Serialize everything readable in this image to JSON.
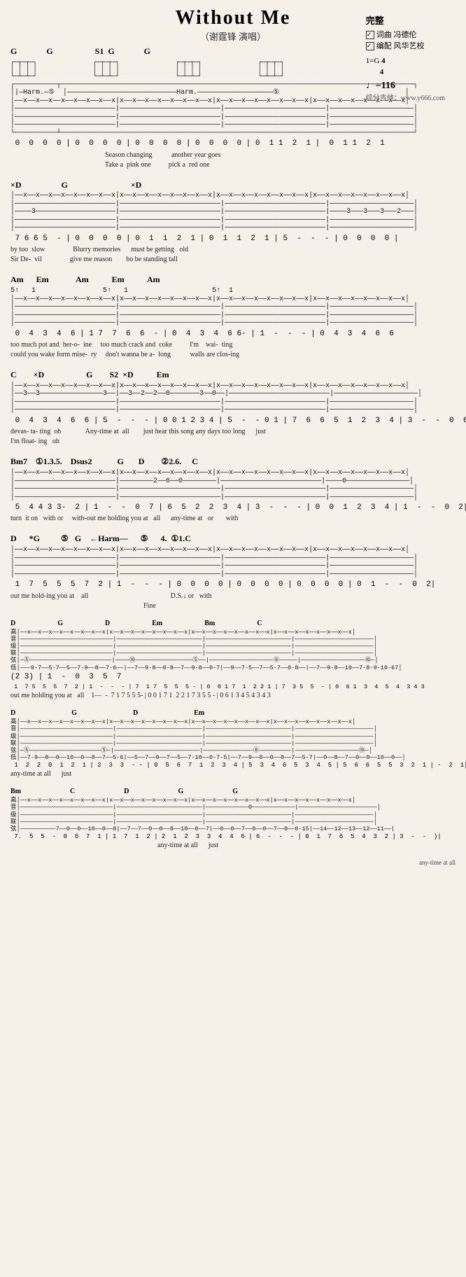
{
  "title": "Without Me",
  "subtitle": "（谢霆锋 演唱）",
  "info": {
    "complete_label": "完整",
    "lyric_label": "词曲 冯德伦",
    "arrange_label": "编配 风华艺校",
    "key": "1=G",
    "time_sig": "4/4",
    "tempo": "♩=116",
    "source": "综分吉他：www.y666.com"
  },
  "sections": []
}
